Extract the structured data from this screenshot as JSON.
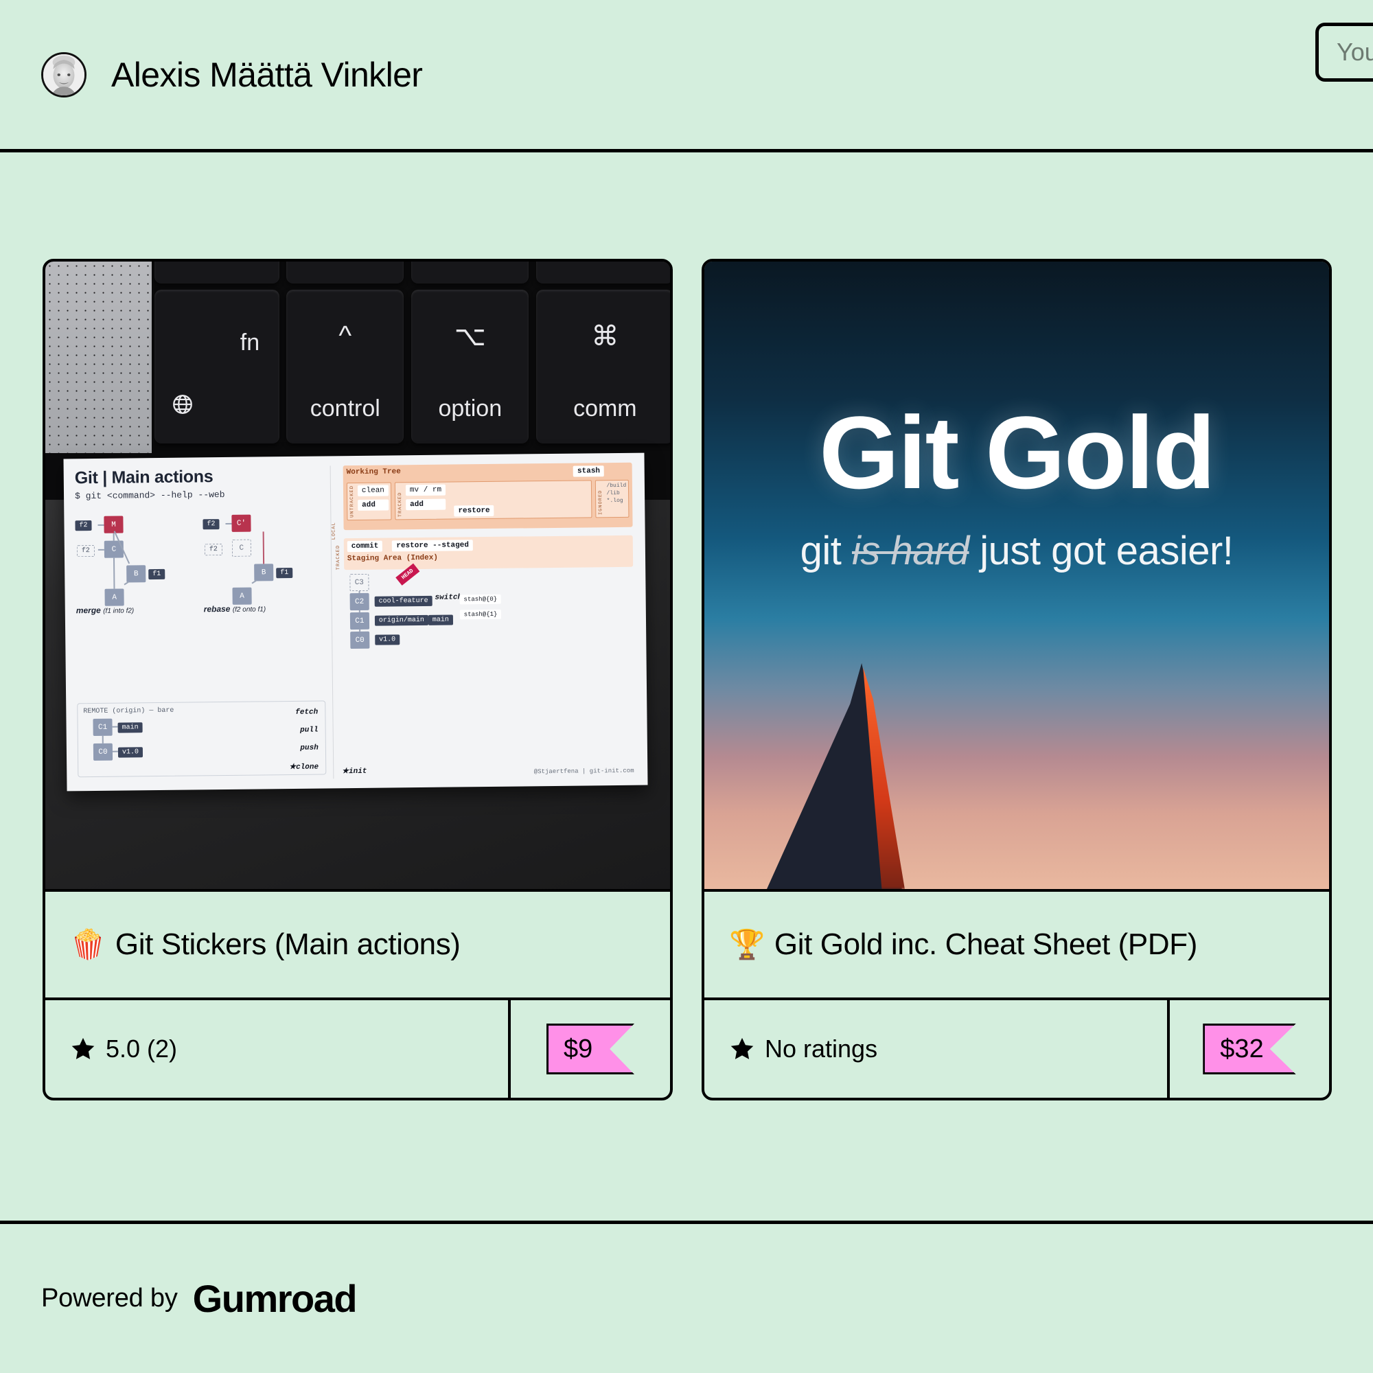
{
  "page": {
    "background_color": "#d4eedd",
    "accent_color": "#ff90e8",
    "border_color": "#000000"
  },
  "header": {
    "creator_name": "Alexis Määttä Vinkler",
    "avatar_icon": "user-avatar-photo",
    "search": {
      "placeholder": "Your email address",
      "value": ""
    }
  },
  "products": [
    {
      "emoji": "🍿",
      "title": "Git Stickers (Main actions)",
      "rating_icon": "star-icon",
      "rating_text": "5.0 (2)",
      "rating_value": "5.0",
      "rating_count": "2",
      "price": "$9",
      "thumbnail": {
        "type": "photo",
        "description": "macbook-keyboard-with-git-sticker",
        "keys": [
          {
            "label": "fn",
            "secondary_icon": "globe-icon"
          },
          {
            "label": "control",
            "symbol": "^"
          },
          {
            "label": "option",
            "symbol": "⌥"
          },
          {
            "label": "comm",
            "symbol": "⌘"
          }
        ],
        "sticker": {
          "title": "Git | Main actions",
          "subtitle": "$ git <command> --help --web",
          "diagrams": [
            {
              "caption": "merge",
              "caption_note": "(f1 into f2)",
              "nodes": [
                "M",
                "C",
                "B",
                "A"
              ],
              "tags": [
                "f2",
                "f2",
                "f1"
              ]
            },
            {
              "caption": "rebase",
              "caption_note": "(f2 onto f1)",
              "nodes": [
                "C'",
                "C",
                "B",
                "A"
              ],
              "tags": [
                "f2",
                "f2",
                "f1"
              ]
            }
          ],
          "remote": {
            "label": "REMOTE (origin) — bare",
            "nodes": [
              "C1",
              "C0"
            ],
            "tags": [
              "main",
              "v1.0"
            ],
            "arrows": [
              "fetch",
              "pull",
              "push",
              "★clone"
            ]
          },
          "workflow": {
            "working_tree_label": "Working Tree",
            "staging_label": "Staging Area (Index)",
            "lanes": [
              "LOCAL",
              "UNTRACKED",
              "TRACKED",
              "IGNORED",
              "TRACKED"
            ],
            "commands": [
              "clean",
              "mv / rm",
              "add",
              "add",
              "restore",
              "commit",
              "restore --staged",
              "stash",
              "switch"
            ],
            "ignored_entries": [
              "/build",
              "/lib",
              "*.log"
            ],
            "commits": [
              "C3",
              "C2",
              "C1",
              "C0"
            ],
            "refs": [
              "cool-feature",
              "origin/main",
              "main",
              "v1.0",
              "HEAD"
            ],
            "stash_refs": [
              "stash@{0}",
              "stash@{1}"
            ],
            "init_label": "★init",
            "credit": "@Stjaertfena | git-init.com"
          }
        }
      }
    },
    {
      "emoji": "🏆",
      "title": "Git Gold inc. Cheat Sheet (PDF)",
      "rating_icon": "star-icon",
      "rating_text": "No ratings",
      "rating_value": "",
      "rating_count": "0",
      "price": "$32",
      "thumbnail": {
        "type": "cover",
        "description": "git-gold-mountain-sunset-cover",
        "headline": "Git Gold",
        "tagline_before": "git ",
        "tagline_struck": "is hard",
        "tagline_after": " just got easier!"
      }
    }
  ],
  "footer": {
    "powered_by": "Powered by",
    "brand": "Gumroad"
  }
}
